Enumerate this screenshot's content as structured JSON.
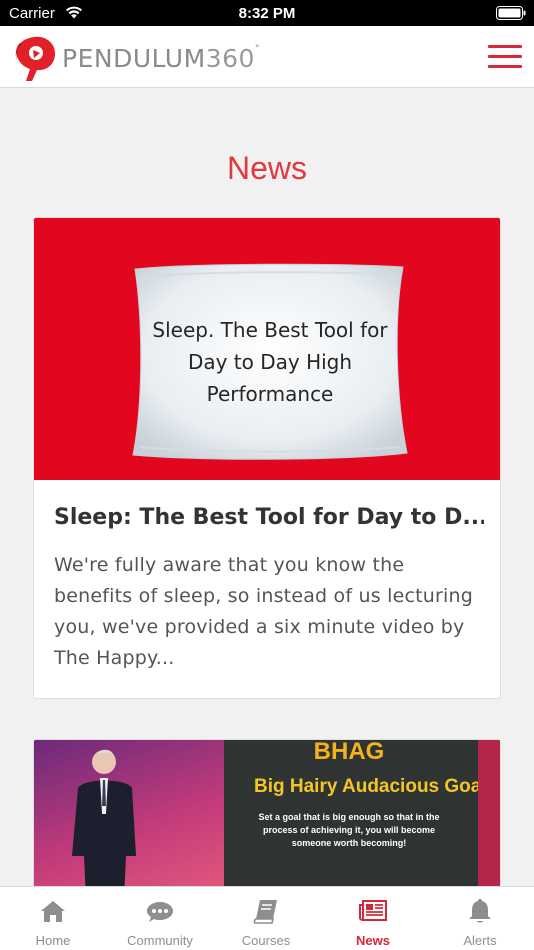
{
  "status_bar": {
    "carrier": "Carrier",
    "time": "8:32 PM"
  },
  "header": {
    "brand_name": "PENDULUM",
    "brand_number": "360",
    "brand_mark": "°"
  },
  "page": {
    "title": "News"
  },
  "articles": [
    {
      "image_text": "Sleep. The Best Tool for Day to Day High Performance",
      "title": "Sleep: The Best Tool for Day to D...",
      "excerpt": "We're fully aware that you know the benefits of sleep, so instead of us lecturing you, we've provided a six minute video by The Happy..."
    },
    {
      "image_heading": "BHAG",
      "image_subheading": "Big Hairy Audacious Goal",
      "image_text": "Set a goal that is big enough so that in the process of achieving it, you will become someone worth becoming!"
    }
  ],
  "tabs": [
    {
      "label": "Home",
      "icon": "home-icon",
      "active": false
    },
    {
      "label": "Community",
      "icon": "chat-icon",
      "active": false
    },
    {
      "label": "Courses",
      "icon": "book-icon",
      "active": false
    },
    {
      "label": "News",
      "icon": "newspaper-icon",
      "active": true
    },
    {
      "label": "Alerts",
      "icon": "bell-icon",
      "active": false
    }
  ],
  "colors": {
    "accent": "#d5283b",
    "hero_red": "#e3061f",
    "tab_inactive": "#8e8e8e"
  }
}
